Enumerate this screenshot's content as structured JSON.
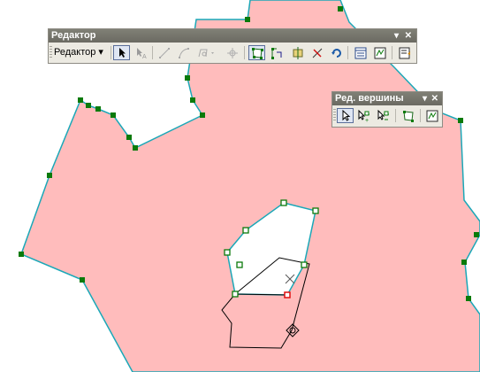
{
  "editor_toolbar": {
    "title": "Редактор",
    "menu_label": "Редактор",
    "menu_arrow": "▾",
    "controls": {
      "dropdown": "▾",
      "close": "✕"
    }
  },
  "vertex_toolbar": {
    "title": "Ред. вершины",
    "controls": {
      "dropdown": "▾",
      "close": "✕"
    }
  },
  "colors": {
    "polygon_fill": "#ffbcbc",
    "polygon_outline": "#1aa8b8",
    "vertex": "#0a7a0a",
    "selected_vertex": "#e01010",
    "sketch_line": "#000000"
  }
}
